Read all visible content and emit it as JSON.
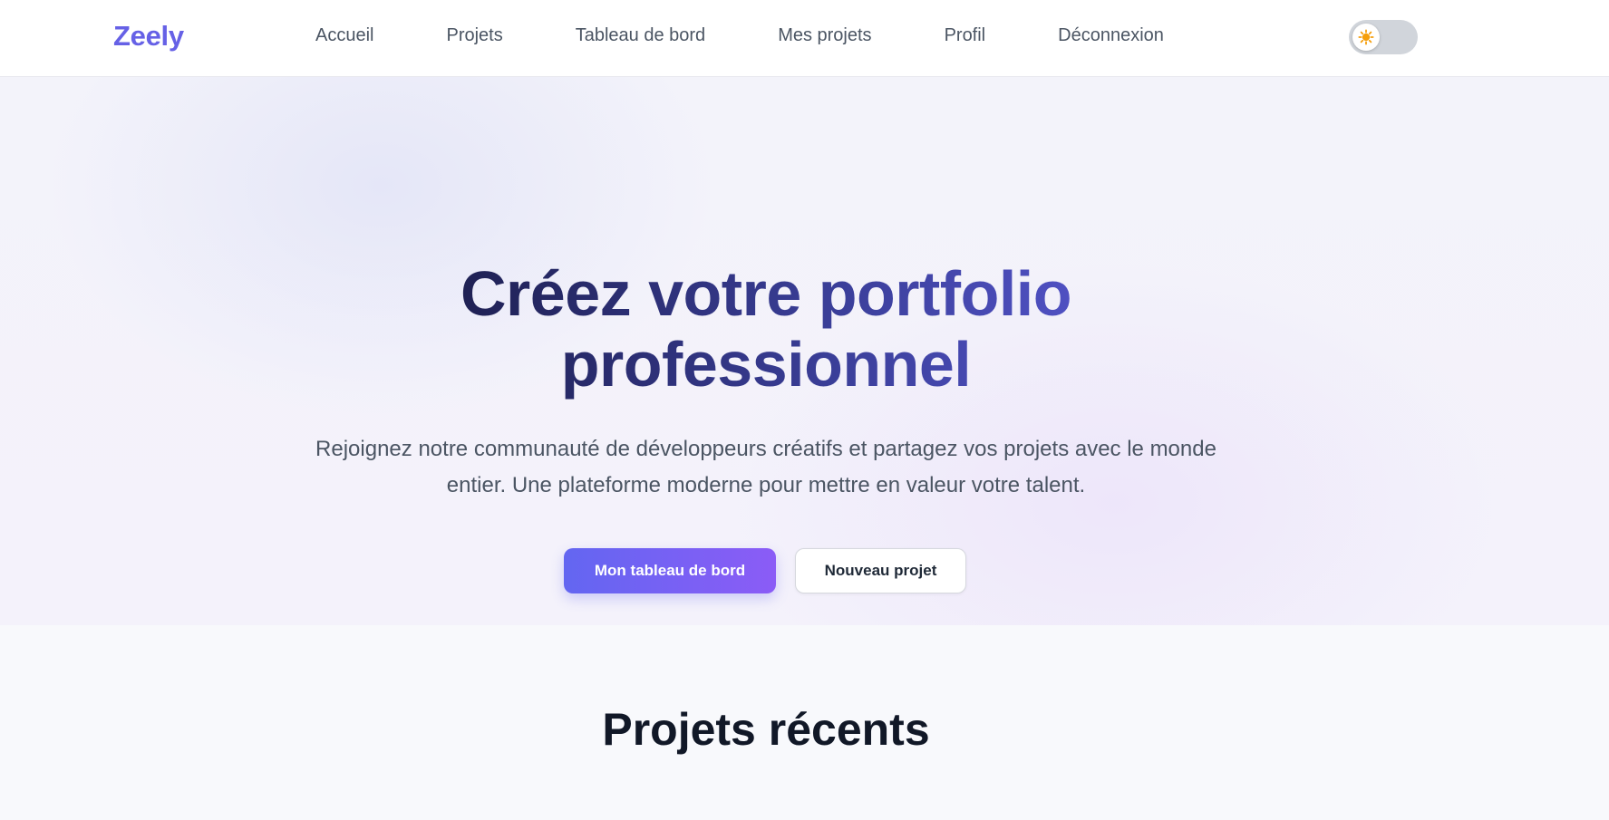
{
  "nav": {
    "logo": "Zeely",
    "links": [
      "Accueil",
      "Projets",
      "Tableau de bord",
      "Mes projets",
      "Profil",
      "Déconnexion"
    ],
    "theme_toggle_icon": "sun-icon"
  },
  "hero": {
    "title_line1": "Créez votre portfolio",
    "title_line2": "professionnel",
    "subtitle": "Rejoignez notre communauté de développeurs créatifs et partagez vos projets avec le monde entier. Une plateforme moderne pour mettre en valeur votre talent.",
    "primary_button": "Mon tableau de bord",
    "secondary_button": "Nouveau projet"
  },
  "recent": {
    "title": "Projets récents"
  },
  "colors": {
    "brand": "#6661e6",
    "button_gradient_start": "#6366f1",
    "button_gradient_end": "#8b5cf6",
    "title_dark": "#1f2154",
    "title_accent": "#5656cf"
  }
}
